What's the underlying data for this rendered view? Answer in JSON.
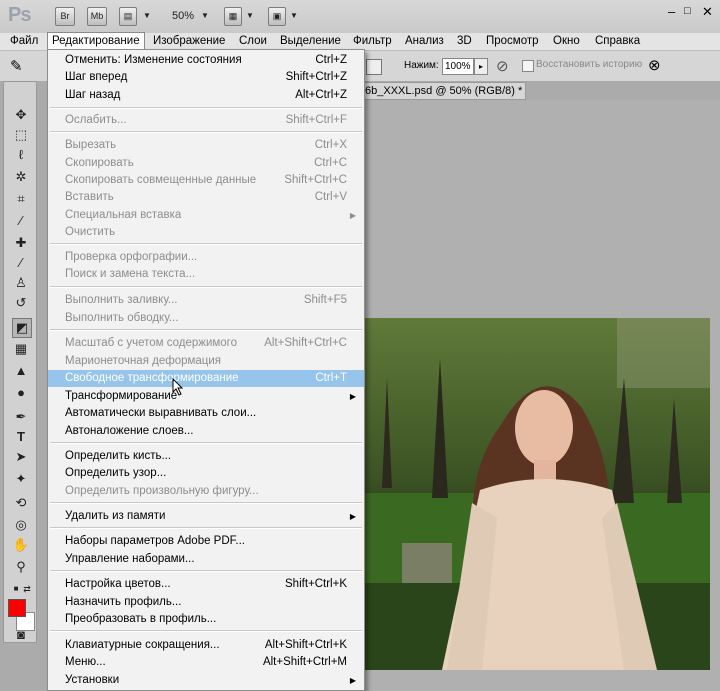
{
  "app": {
    "logo": "Ps",
    "br": "Br",
    "mb": "Mb",
    "zoom": "50%"
  },
  "menubar": [
    "Файл",
    "Редактирование",
    "Изображение",
    "Слои",
    "Выделение",
    "Фильтр",
    "Анализ",
    "3D",
    "Просмотр",
    "Окно",
    "Справка"
  ],
  "options": {
    "pressure_label": "Нажим:",
    "pressure_value": "100%",
    "restore_history": "Восстановить историю"
  },
  "document_tab": "6b_XXXL.psd @ 50% (RGB/8) *",
  "edit_menu": [
    {
      "label": "Отменить: Изменение состояния",
      "shortcut": "Ctrl+Z",
      "state": "enabled"
    },
    {
      "label": "Шаг вперед",
      "shortcut": "Shift+Ctrl+Z",
      "state": "enabled"
    },
    {
      "label": "Шаг назад",
      "shortcut": "Alt+Ctrl+Z",
      "state": "enabled"
    },
    {
      "label": "Ослабить...",
      "shortcut": "Shift+Ctrl+F",
      "state": "disabled"
    },
    {
      "label": "Вырезать",
      "shortcut": "Ctrl+X",
      "state": "disabled"
    },
    {
      "label": "Скопировать",
      "shortcut": "Ctrl+C",
      "state": "disabled"
    },
    {
      "label": "Скопировать совмещенные данные",
      "shortcut": "Shift+Ctrl+C",
      "state": "disabled"
    },
    {
      "label": "Вставить",
      "shortcut": "Ctrl+V",
      "state": "disabled"
    },
    {
      "label": "Специальная вставка",
      "shortcut": "",
      "state": "disabled",
      "submenu": true
    },
    {
      "label": "Очистить",
      "shortcut": "",
      "state": "disabled"
    },
    {
      "label": "Проверка орфографии...",
      "shortcut": "",
      "state": "disabled"
    },
    {
      "label": "Поиск и замена текста...",
      "shortcut": "",
      "state": "disabled"
    },
    {
      "label": "Выполнить заливку...",
      "shortcut": "Shift+F5",
      "state": "disabled"
    },
    {
      "label": "Выполнить обводку...",
      "shortcut": "",
      "state": "disabled"
    },
    {
      "label": "Масштаб с учетом содержимого",
      "shortcut": "Alt+Shift+Ctrl+C",
      "state": "disabled"
    },
    {
      "label": "Марионеточная деформация",
      "shortcut": "",
      "state": "disabled"
    },
    {
      "label": "Свободное трансформирование",
      "shortcut": "Ctrl+T",
      "state": "highlighted"
    },
    {
      "label": "Трансформирование",
      "shortcut": "",
      "state": "enabled",
      "submenu": true
    },
    {
      "label": "Автоматически выравнивать слои...",
      "shortcut": "",
      "state": "enabled"
    },
    {
      "label": "Автоналожение слоев...",
      "shortcut": "",
      "state": "enabled"
    },
    {
      "label": "Определить кисть...",
      "shortcut": "",
      "state": "enabled"
    },
    {
      "label": "Определить узор...",
      "shortcut": "",
      "state": "enabled"
    },
    {
      "label": "Определить произвольную фигуру...",
      "shortcut": "",
      "state": "disabled"
    },
    {
      "label": "Удалить из памяти",
      "shortcut": "",
      "state": "enabled",
      "submenu": true
    },
    {
      "label": "Наборы параметров Adobe PDF...",
      "shortcut": "",
      "state": "enabled"
    },
    {
      "label": "Управление наборами...",
      "shortcut": "",
      "state": "enabled"
    },
    {
      "label": "Настройка цветов...",
      "shortcut": "Shift+Ctrl+K",
      "state": "enabled"
    },
    {
      "label": "Назначить профиль...",
      "shortcut": "",
      "state": "enabled"
    },
    {
      "label": "Преобразовать в профиль...",
      "shortcut": "",
      "state": "enabled"
    },
    {
      "label": "Клавиатурные сокращения...",
      "shortcut": "Alt+Shift+Ctrl+K",
      "state": "enabled"
    },
    {
      "label": "Меню...",
      "shortcut": "Alt+Shift+Ctrl+M",
      "state": "enabled"
    },
    {
      "label": "Установки",
      "shortcut": "",
      "state": "enabled",
      "submenu": true
    }
  ],
  "colors": {
    "foreground": "#ff0000",
    "background": "#ffffff",
    "highlight": "#96c4ea"
  }
}
